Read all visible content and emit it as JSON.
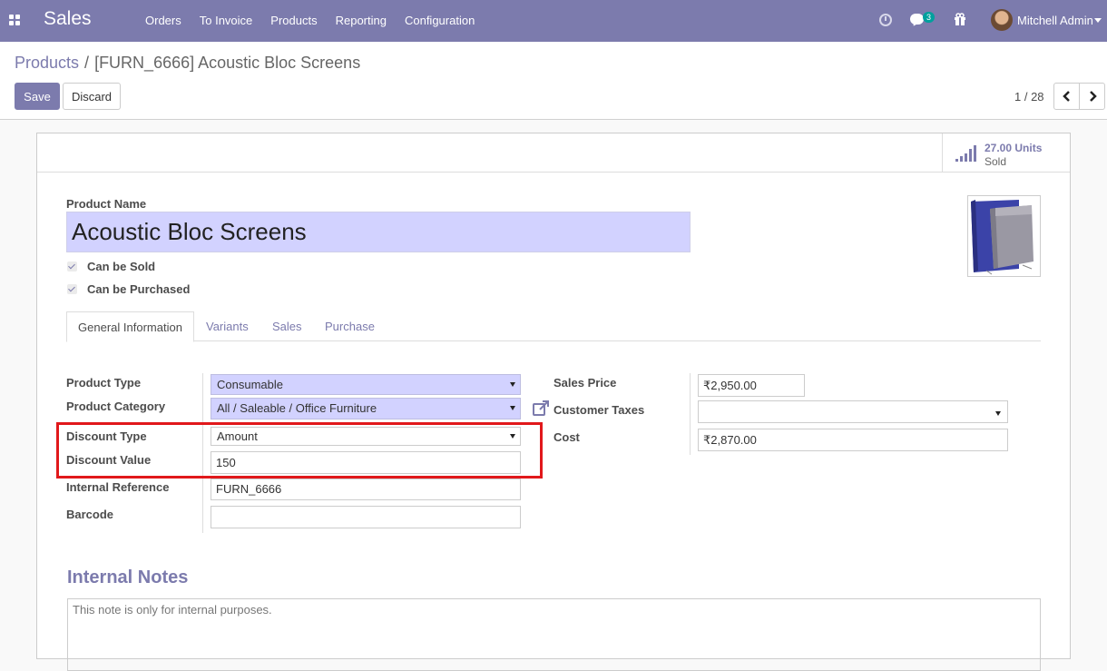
{
  "navbar": {
    "app_title": "Sales",
    "menu": [
      "Orders",
      "To Invoice",
      "Products",
      "Reporting",
      "Configuration"
    ],
    "chat_count": "3",
    "user_name": "Mitchell Admin",
    "accent_color": "#7c7bad"
  },
  "breadcrumb": {
    "parent": "Products",
    "separator": "/",
    "current": "[FURN_6666] Acoustic Bloc Screens"
  },
  "toolbar": {
    "save_label": "Save",
    "discard_label": "Discard",
    "pager_value": "1 / 28"
  },
  "stat_button": {
    "value": "27.00 Units",
    "label": "Sold",
    "icon": "bar-chart-icon"
  },
  "form": {
    "product_name_label": "Product Name",
    "product_name": "Acoustic Bloc Screens",
    "can_be_sold_label": "Can be Sold",
    "can_be_sold": true,
    "can_be_purchased_label": "Can be Purchased",
    "can_be_purchased": true
  },
  "tabs": [
    {
      "label": "General Information",
      "active": true
    },
    {
      "label": "Variants",
      "active": false
    },
    {
      "label": "Sales",
      "active": false
    },
    {
      "label": "Purchase",
      "active": false
    }
  ],
  "general": {
    "product_type_label": "Product Type",
    "product_type": "Consumable",
    "product_category_label": "Product Category",
    "product_category": "All / Saleable / Office Furniture",
    "discount_type_label": "Discount Type",
    "discount_type": "Amount",
    "discount_value_label": "Discount Value",
    "discount_value": "150",
    "internal_reference_label": "Internal Reference",
    "internal_reference": "FURN_6666",
    "barcode_label": "Barcode",
    "barcode": "",
    "sales_price_label": "Sales Price",
    "sales_price": "₹2,950.00",
    "customer_taxes_label": "Customer Taxes",
    "customer_taxes": "",
    "cost_label": "Cost",
    "cost": "₹2,870.00",
    "highlight_color": "#e1181b"
  },
  "notes": {
    "title": "Internal Notes",
    "placeholder": "This note is only for internal purposes."
  }
}
